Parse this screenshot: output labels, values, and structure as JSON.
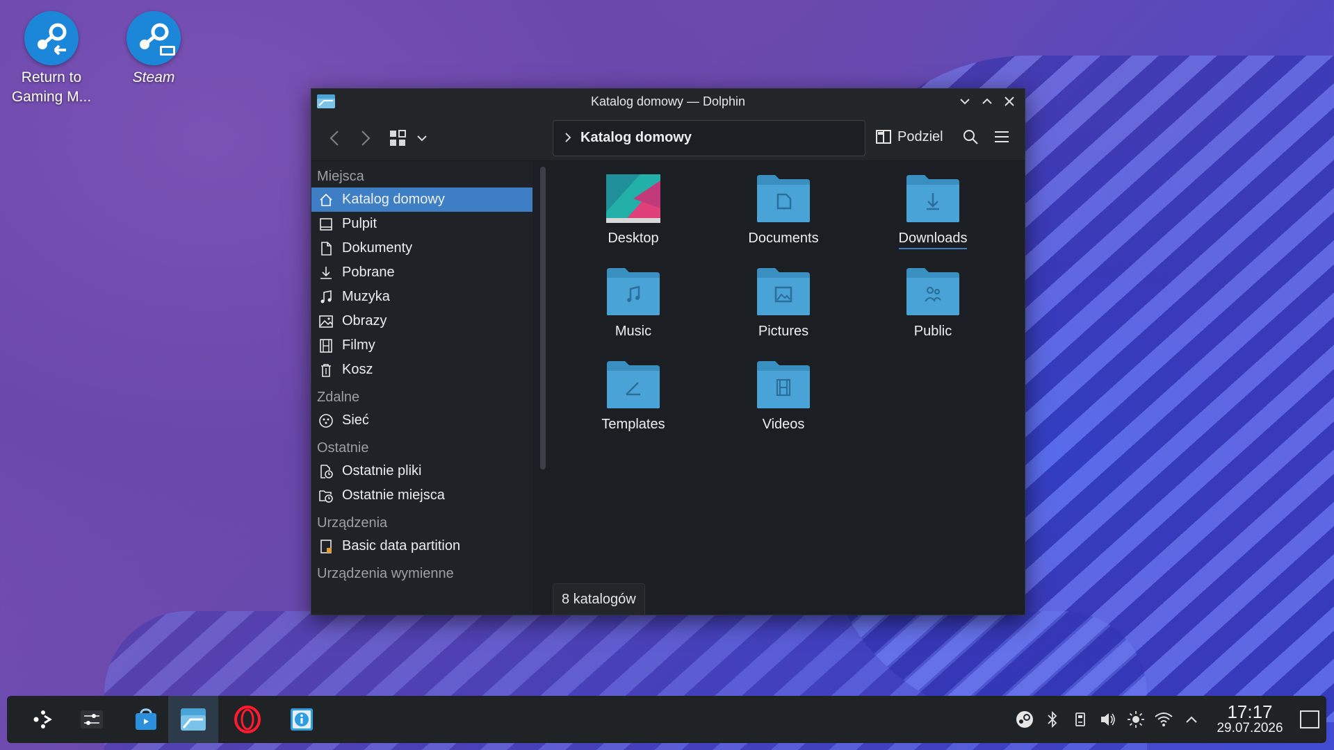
{
  "desktop": {
    "icons": [
      {
        "label": "Return to\nGaming M..."
      },
      {
        "label": "Steam"
      }
    ]
  },
  "window": {
    "title": "Katalog domowy — Dolphin",
    "breadcrumb": "Katalog domowy",
    "split_label": "Podziel"
  },
  "sidebar": {
    "sections": {
      "places": "Miejsca",
      "remote": "Zdalne",
      "recent": "Ostatnie",
      "devices": "Urządzenia",
      "removable": "Urządzenia wymienne"
    },
    "places": [
      "Katalog domowy",
      "Pulpit",
      "Dokumenty",
      "Pobrane",
      "Muzyka",
      "Obrazy",
      "Filmy",
      "Kosz"
    ],
    "remote": [
      "Sieć"
    ],
    "recent": [
      "Ostatnie pliki",
      "Ostatnie miejsca"
    ],
    "devices": [
      "Basic data partition"
    ]
  },
  "content": {
    "folders": [
      "Desktop",
      "Documents",
      "Downloads",
      "Music",
      "Pictures",
      "Public",
      "Templates",
      "Videos"
    ],
    "status": "8 katalogów"
  },
  "taskbar": {
    "time": "17:17",
    "date": "29.07.2026"
  },
  "colors": {
    "accent": "#3e7ec5",
    "folder": "#4aa3d6"
  }
}
